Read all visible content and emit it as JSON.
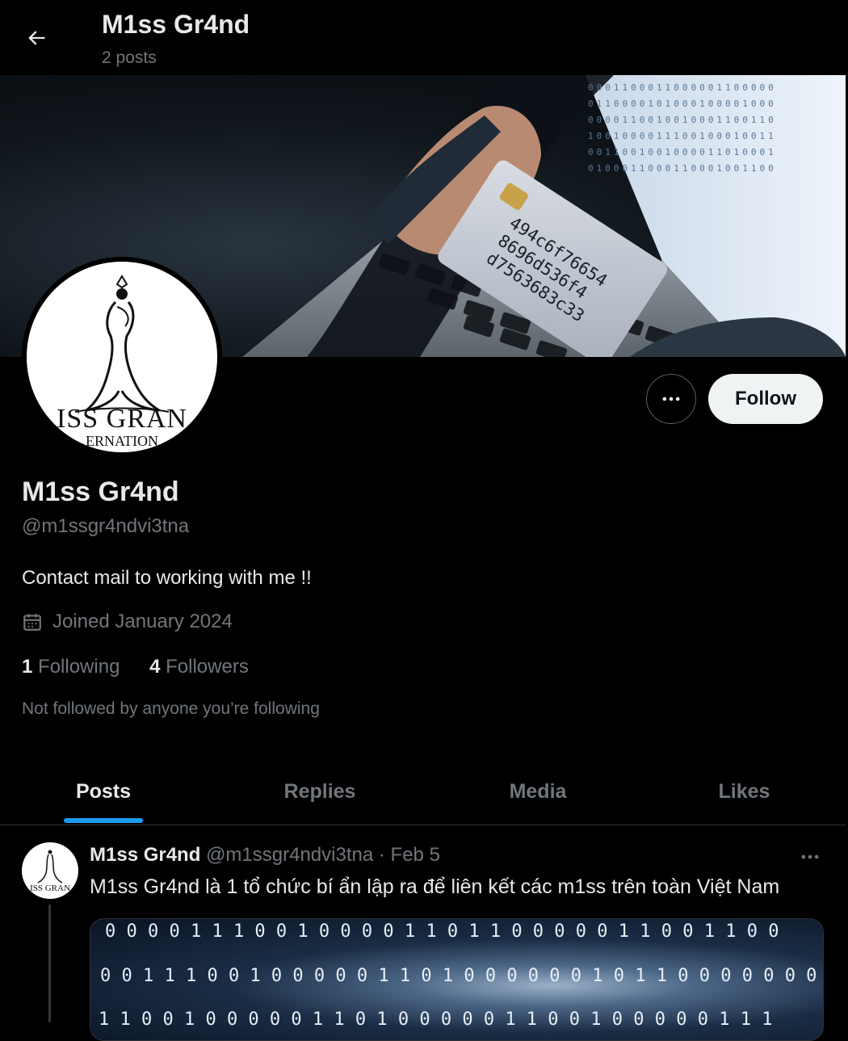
{
  "header": {
    "title": "M1ss Gr4nd",
    "post_count": "2 posts"
  },
  "banner": {
    "card_lines": [
      "494c6f76654",
      "8696d536f4",
      "d7563683c33"
    ],
    "binary_rows": [
      "0001100011000001100000",
      "0110000101000100001000",
      "0000110010010001100110",
      "1001000011100100010011",
      "0011001001000011010001",
      "0100011000110001001100"
    ]
  },
  "avatar": {
    "logo_text": "ISS GRAN",
    "logo_subtext": "ERNATION"
  },
  "profile": {
    "display_name": "M1ss Gr4nd",
    "handle": "@m1ssgr4ndvi3tna",
    "bio": "Contact mail to working with me !!",
    "joined": "Joined January 2024",
    "following_count": "1",
    "following_label": "Following",
    "followers_count": "4",
    "followers_label": "Followers",
    "not_followed": "Not followed by anyone you’re following"
  },
  "actions": {
    "follow_label": "Follow",
    "more_icon": "more-horizontal-icon"
  },
  "tabs": [
    {
      "label": "Posts",
      "active": true
    },
    {
      "label": "Replies",
      "active": false
    },
    {
      "label": "Media",
      "active": false
    },
    {
      "label": "Likes",
      "active": false
    }
  ],
  "post": {
    "name": "M1ss Gr4nd",
    "handle": "@m1ssgr4ndvi3tna",
    "dot": "·",
    "date": "Feb 5",
    "text": "M1ss Gr4nd là 1 tổ chức bí ẩn lập ra để liên kết các m1ss trên toàn Việt Nam",
    "avatar_text": "ISS GRAN",
    "media_rows": [
      "0 0 0 0 1 1 1 0 0 1 0 0 0 0 1 1 0 1 1 0 0 0 0 0 1 1 0 0 1 1 0 0",
      "0 0 1 1 1 0 0 1 0 0 0 0 0 1 1 0 1 0 0 0 0 0 0 1 0 1 1 0 0 0 0 0 0 0",
      "1 1 0 0 1 0 0 0 0 0 1 1 0 1 0 0 0 0 0 1 1 0 0 1 0 0 0 0 0 1 1 1"
    ]
  },
  "colors": {
    "accent": "#1d9bf0",
    "muted": "#71767b",
    "text": "#e7e9ea",
    "background": "#000000"
  }
}
